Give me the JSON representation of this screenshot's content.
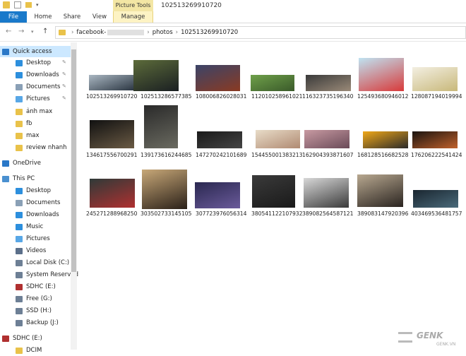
{
  "window": {
    "title": "102513269910720",
    "context_group": "Picture Tools"
  },
  "ribbon": {
    "tabs": [
      "File",
      "Home",
      "Share",
      "View",
      "Manage"
    ]
  },
  "address": {
    "segments": [
      "facebook-",
      "photos",
      "102513269910720"
    ]
  },
  "colors": {
    "accent": "#1979ca",
    "selection": "#cce8ff",
    "context_tab": "#f3e6a4",
    "folder": "#e9c24a"
  },
  "nav": {
    "items": [
      {
        "label": "Quick access",
        "icon": "star-icon",
        "color": "#2a78c8"
      },
      {
        "label": "Desktop",
        "icon": "desktop-icon",
        "color": "#2d8fdd"
      },
      {
        "label": "Downloads",
        "icon": "download-icon",
        "color": "#2d8fdd"
      },
      {
        "label": "Documents",
        "icon": "documents-icon",
        "color": "#8aa0b6"
      },
      {
        "label": "Pictures",
        "icon": "pictures-icon",
        "color": "#58a7e6"
      },
      {
        "label": "ảnh max",
        "icon": "folder-icon",
        "color": "#e9c24a"
      },
      {
        "label": "fb",
        "icon": "folder-icon",
        "color": "#e9c24a"
      },
      {
        "label": "max",
        "icon": "folder-icon",
        "color": "#e9c24a"
      },
      {
        "label": "review nhanh",
        "icon": "folder-icon",
        "color": "#e9c24a"
      },
      {
        "label": "OneDrive",
        "icon": "cloud-icon",
        "color": "#2a78c8"
      },
      {
        "label": "This PC",
        "icon": "computer-icon",
        "color": "#4a90d0"
      },
      {
        "label": "Desktop",
        "icon": "desktop-icon",
        "color": "#2d8fdd"
      },
      {
        "label": "Documents",
        "icon": "documents-icon",
        "color": "#8aa0b6"
      },
      {
        "label": "Downloads",
        "icon": "download-icon",
        "color": "#2d8fdd"
      },
      {
        "label": "Music",
        "icon": "music-icon",
        "color": "#2d8fdd"
      },
      {
        "label": "Pictures",
        "icon": "pictures-icon",
        "color": "#58a7e6"
      },
      {
        "label": "Videos",
        "icon": "videos-icon",
        "color": "#5b6f8a"
      },
      {
        "label": "Local Disk (C:)",
        "icon": "drive-icon",
        "color": "#6d7f95"
      },
      {
        "label": "System Reserved",
        "icon": "drive-icon",
        "color": "#6d7f95"
      },
      {
        "label": "SDHC (E:)",
        "icon": "sd-card-icon",
        "color": "#b03030"
      },
      {
        "label": "Free (G:)",
        "icon": "drive-icon",
        "color": "#6d7f95"
      },
      {
        "label": "SSD (H:)",
        "icon": "drive-icon",
        "color": "#6d7f95"
      },
      {
        "label": "Backup (J:)",
        "icon": "drive-icon",
        "color": "#6d7f95"
      },
      {
        "label": "SDHC (E:)",
        "icon": "sd-card-icon",
        "color": "#b03030"
      },
      {
        "label": "DCIM",
        "icon": "folder-icon",
        "color": "#e9c24a"
      }
    ]
  },
  "files": [
    {
      "name": "102513269910720",
      "c1": "#aab7c2",
      "c2": "#2b3642"
    },
    {
      "name": "102513286577385",
      "c1": "#5c6b3a",
      "c2": "#1a1f22"
    },
    {
      "name": "108006826028031",
      "c1": "#3b4468",
      "c2": "#8a3a22"
    },
    {
      "name": "112010258961021",
      "c1": "#6fa04a",
      "c2": "#3a5a2a"
    },
    {
      "name": "116323735196340",
      "c1": "#3a3a3a",
      "c2": "#9a8a78"
    },
    {
      "name": "125493680946012",
      "c1": "#bfe3f2",
      "c2": "#d83a3a"
    },
    {
      "name": "128087194019994",
      "c1": "#f3efe2",
      "c2": "#c8b87a"
    },
    {
      "name": "134617556700291",
      "c1": "#111111",
      "c2": "#6a5a44"
    },
    {
      "name": "139173616244685",
      "c1": "#2a2a2a",
      "c2": "#6a6a60"
    },
    {
      "name": "147270242101689",
      "c1": "#1a1a1a",
      "c2": "#444444"
    },
    {
      "name": "154455001383213",
      "c1": "#e8dcc8",
      "c2": "#b08a72"
    },
    {
      "name": "162904393871607",
      "c1": "#c89aa2",
      "c2": "#6a4a58"
    },
    {
      "name": "168128516682528",
      "c1": "#f0a818",
      "c2": "#2a2a2a"
    },
    {
      "name": "176206222541424",
      "c1": "#1a1410",
      "c2": "#c0602a"
    },
    {
      "name": "245271288968250",
      "c1": "#2f3a38",
      "c2": "#b03030"
    },
    {
      "name": "303502733145105",
      "c1": "#c8a878",
      "c2": "#2a2018"
    },
    {
      "name": "307723976056314",
      "c1": "#2a2850",
      "c2": "#6a5a9a"
    },
    {
      "name": "380541122107932",
      "c1": "#3a3a3a",
      "c2": "#1a1a1a"
    },
    {
      "name": "389082564587121",
      "c1": "#d8d8d8",
      "c2": "#3a3a3a"
    },
    {
      "name": "389083147920396",
      "c1": "#b8a890",
      "c2": "#2a2420"
    },
    {
      "name": "403469536481757",
      "c1": "#1a2630",
      "c2": "#4a6a7a"
    }
  ],
  "watermark": {
    "brand": "GENK",
    "site": "GENK.VN"
  }
}
